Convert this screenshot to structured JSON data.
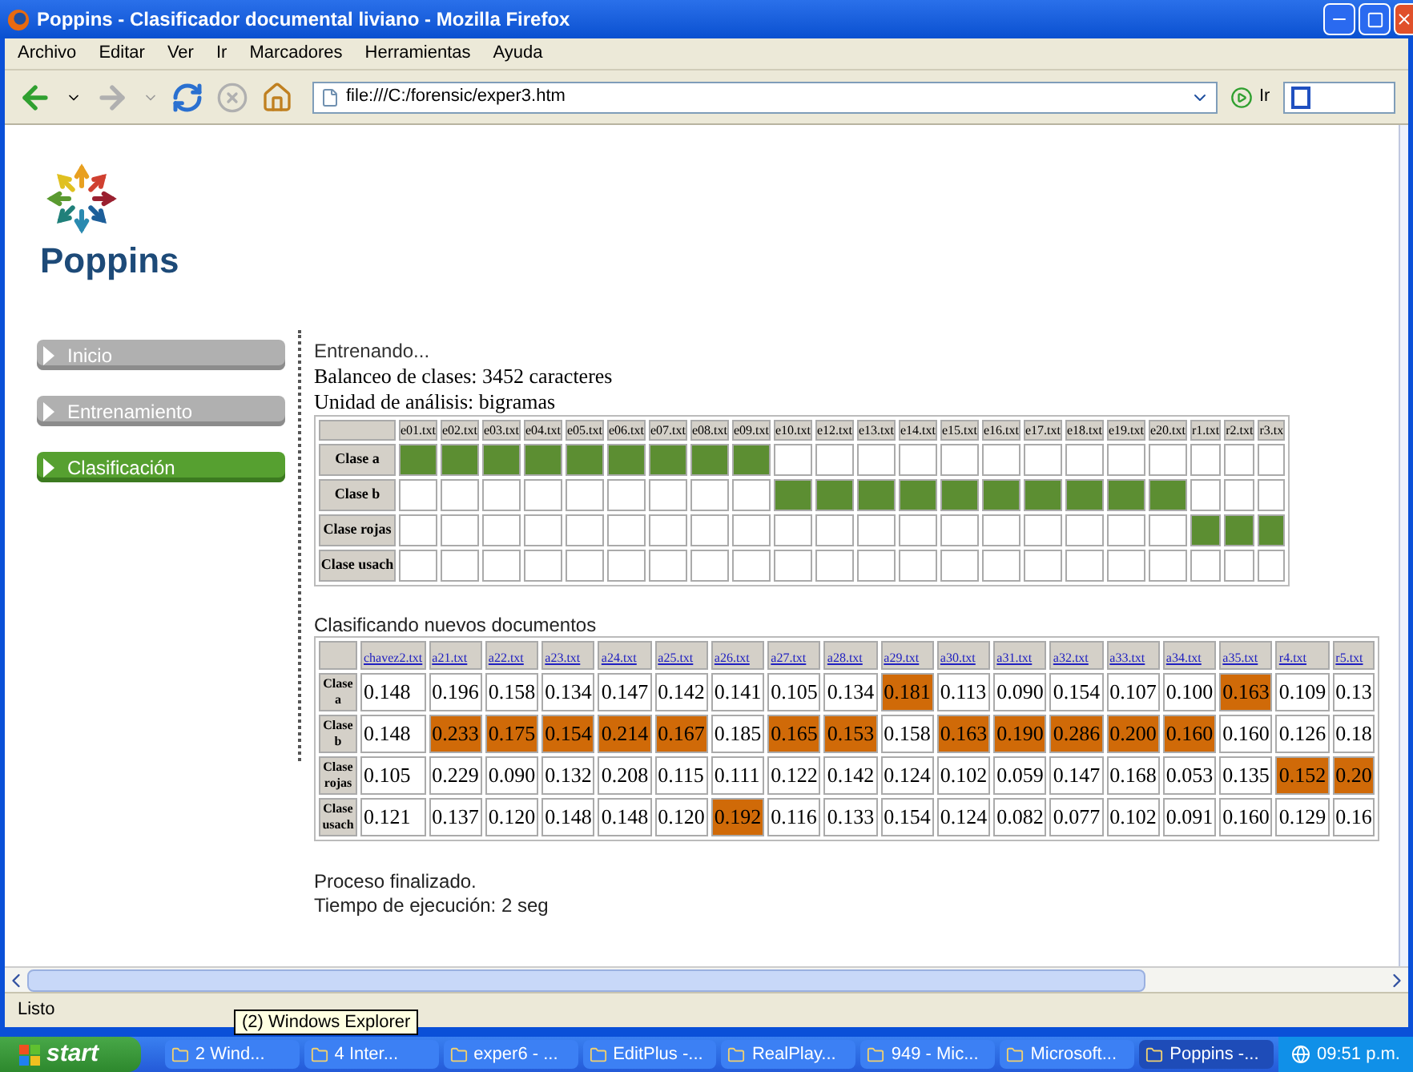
{
  "window": {
    "title": "Poppins - Clasificador documental liviano - Mozilla Firefox"
  },
  "menu": [
    "Archivo",
    "Editar",
    "Ver",
    "Ir",
    "Marcadores",
    "Herramientas",
    "Ayuda"
  ],
  "toolbar": {
    "address": "file:///C:/forensic/exper3.htm",
    "go_label": "Ir"
  },
  "logo": {
    "text": "Poppins"
  },
  "nav": [
    {
      "label": "Inicio",
      "selected": false
    },
    {
      "label": "Entrenamiento",
      "selected": false
    },
    {
      "label": "Clasificación",
      "selected": true
    }
  ],
  "training": {
    "status": "Entrenando...",
    "lines": [
      "Balanceo de clases: 3452 caracteres",
      "Unidad de análisis: bigramas"
    ],
    "columns": [
      "e01.txt",
      "e02.txt",
      "e03.txt",
      "e04.txt",
      "e05.txt",
      "e06.txt",
      "e07.txt",
      "e08.txt",
      "e09.txt",
      "e10.txt",
      "e12.txt",
      "e13.txt",
      "e14.txt",
      "e15.txt",
      "e16.txt",
      "e17.txt",
      "e18.txt",
      "e19.txt",
      "e20.txt",
      "r1.txt",
      "r2.txt",
      "r3.tx"
    ],
    "rows": [
      {
        "label": "Clase a",
        "cells": [
          true,
          true,
          true,
          true,
          true,
          true,
          true,
          true,
          true,
          false,
          false,
          false,
          false,
          false,
          false,
          false,
          false,
          false,
          false,
          false,
          false,
          false
        ]
      },
      {
        "label": "Clase b",
        "cells": [
          false,
          false,
          false,
          false,
          false,
          false,
          false,
          false,
          false,
          true,
          true,
          true,
          true,
          true,
          true,
          true,
          true,
          true,
          true,
          false,
          false,
          false
        ]
      },
      {
        "label": "Clase rojas",
        "cells": [
          false,
          false,
          false,
          false,
          false,
          false,
          false,
          false,
          false,
          false,
          false,
          false,
          false,
          false,
          false,
          false,
          false,
          false,
          false,
          true,
          true,
          true
        ]
      },
      {
        "label": "Clase usach",
        "cells": [
          false,
          false,
          false,
          false,
          false,
          false,
          false,
          false,
          false,
          false,
          false,
          false,
          false,
          false,
          false,
          false,
          false,
          false,
          false,
          false,
          false,
          false
        ]
      }
    ]
  },
  "classification": {
    "title": "Clasificando nuevos documentos",
    "columns": [
      "chavez2.txt",
      "a21.txt",
      "a22.txt",
      "a23.txt",
      "a24.txt",
      "a25.txt",
      "a26.txt",
      "a27.txt",
      "a28.txt",
      "a29.txt",
      "a30.txt",
      "a31.txt",
      "a32.txt",
      "a33.txt",
      "a34.txt",
      "a35.txt",
      "r4.txt",
      "r5.txt"
    ],
    "rows": [
      {
        "label": "Clase a",
        "values": [
          "0.148",
          "0.196",
          "0.158",
          "0.134",
          "0.147",
          "0.142",
          "0.141",
          "0.105",
          "0.134",
          "0.181",
          "0.113",
          "0.090",
          "0.154",
          "0.107",
          "0.100",
          "0.163",
          "0.109",
          "0.13"
        ],
        "highlighted": [
          false,
          false,
          false,
          false,
          false,
          false,
          false,
          false,
          false,
          true,
          false,
          false,
          false,
          false,
          false,
          true,
          false,
          false
        ]
      },
      {
        "label": "Clase b",
        "values": [
          "0.148",
          "0.233",
          "0.175",
          "0.154",
          "0.214",
          "0.167",
          "0.185",
          "0.165",
          "0.153",
          "0.158",
          "0.163",
          "0.190",
          "0.286",
          "0.200",
          "0.160",
          "0.160",
          "0.126",
          "0.18"
        ],
        "highlighted": [
          false,
          true,
          true,
          true,
          true,
          true,
          false,
          true,
          true,
          false,
          true,
          true,
          true,
          true,
          true,
          false,
          false,
          false
        ]
      },
      {
        "label": "Clase rojas",
        "values": [
          "0.105",
          "0.229",
          "0.090",
          "0.132",
          "0.208",
          "0.115",
          "0.111",
          "0.122",
          "0.142",
          "0.124",
          "0.102",
          "0.059",
          "0.147",
          "0.168",
          "0.053",
          "0.135",
          "0.152",
          "0.20"
        ],
        "highlighted": [
          false,
          false,
          false,
          false,
          false,
          false,
          false,
          false,
          false,
          false,
          false,
          false,
          false,
          false,
          false,
          false,
          true,
          true
        ]
      },
      {
        "label": "Clase usach",
        "values": [
          "0.121",
          "0.137",
          "0.120",
          "0.148",
          "0.148",
          "0.120",
          "0.192",
          "0.116",
          "0.133",
          "0.154",
          "0.124",
          "0.082",
          "0.077",
          "0.102",
          "0.091",
          "0.160",
          "0.129",
          "0.16"
        ],
        "highlighted": [
          false,
          false,
          false,
          false,
          false,
          false,
          true,
          false,
          false,
          false,
          false,
          false,
          false,
          false,
          false,
          false,
          false,
          false
        ]
      }
    ]
  },
  "result": [
    "Proceso finalizado.",
    "Tiempo de ejecución: 2 seg"
  ],
  "status_bar": "Listo",
  "tooltip": "(2) Windows Explorer",
  "taskbar": {
    "start": "start",
    "items": [
      {
        "label": "2 Wind...",
        "selected": false
      },
      {
        "label": "4 Inter...",
        "selected": false
      },
      {
        "label": "exper6 - ...",
        "selected": false
      },
      {
        "label": "EditPlus -...",
        "selected": false
      },
      {
        "label": "RealPlay...",
        "selected": false
      },
      {
        "label": "949 - Mic...",
        "selected": false
      },
      {
        "label": "Microsoft...",
        "selected": false
      },
      {
        "label": "Poppins -...",
        "selected": true
      }
    ],
    "clock": "09:51 p.m."
  }
}
